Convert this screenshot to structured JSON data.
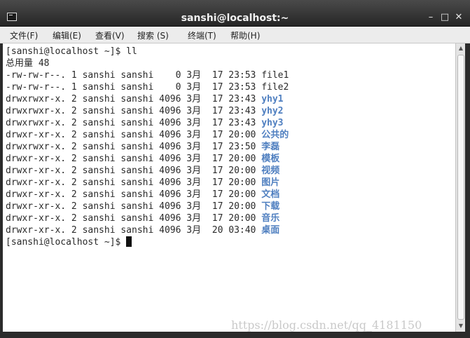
{
  "window": {
    "title": "sanshi@localhost:~",
    "minimize_glyph": "–",
    "maximize_glyph": "□",
    "close_glyph": "✕",
    "icon": "terminal-icon"
  },
  "menubar": {
    "items": [
      "文件(F)",
      "编辑(E)",
      "查看(V)",
      "搜索 (S)",
      "终端(T)",
      "帮助(H)"
    ]
  },
  "terminal": {
    "prompt1": "[sanshi@localhost ~]$ ll",
    "total": "总用量 48",
    "rows": [
      {
        "meta": "-rw-rw-r--. 1 sanshi sanshi    0 3月  17 23:53 ",
        "name": "file1",
        "is_dir": false
      },
      {
        "meta": "-rw-rw-r--. 1 sanshi sanshi    0 3月  17 23:53 ",
        "name": "file2",
        "is_dir": false
      },
      {
        "meta": "drwxrwxr-x. 2 sanshi sanshi 4096 3月  17 23:43 ",
        "name": "yhy1",
        "is_dir": true
      },
      {
        "meta": "drwxrwxr-x. 2 sanshi sanshi 4096 3月  17 23:43 ",
        "name": "yhy2",
        "is_dir": true
      },
      {
        "meta": "drwxrwxr-x. 2 sanshi sanshi 4096 3月  17 23:43 ",
        "name": "yhy3",
        "is_dir": true
      },
      {
        "meta": "drwxr-xr-x. 2 sanshi sanshi 4096 3月  17 20:00 ",
        "name": "公共的",
        "is_dir": true
      },
      {
        "meta": "drwxrwxr-x. 2 sanshi sanshi 4096 3月  17 23:50 ",
        "name": "李磊",
        "is_dir": true
      },
      {
        "meta": "drwxr-xr-x. 2 sanshi sanshi 4096 3月  17 20:00 ",
        "name": "模板",
        "is_dir": true
      },
      {
        "meta": "drwxr-xr-x. 2 sanshi sanshi 4096 3月  17 20:00 ",
        "name": "视频",
        "is_dir": true
      },
      {
        "meta": "drwxr-xr-x. 2 sanshi sanshi 4096 3月  17 20:00 ",
        "name": "图片",
        "is_dir": true
      },
      {
        "meta": "drwxr-xr-x. 2 sanshi sanshi 4096 3月  17 20:00 ",
        "name": "文档",
        "is_dir": true
      },
      {
        "meta": "drwxr-xr-x. 2 sanshi sanshi 4096 3月  17 20:00 ",
        "name": "下载",
        "is_dir": true
      },
      {
        "meta": "drwxr-xr-x. 2 sanshi sanshi 4096 3月  17 20:00 ",
        "name": "音乐",
        "is_dir": true
      },
      {
        "meta": "drwxr-xr-x. 2 sanshi sanshi 4096 3月  20 03:40 ",
        "name": "桌面",
        "is_dir": true
      }
    ],
    "prompt2": "[sanshi@localhost ~]$"
  },
  "colors": {
    "dir_color": "#4f7fc0",
    "text_color": "#2a2a2a",
    "titlebar": "#333333"
  },
  "watermark": "https://blog.csdn.net/qq_4181150"
}
